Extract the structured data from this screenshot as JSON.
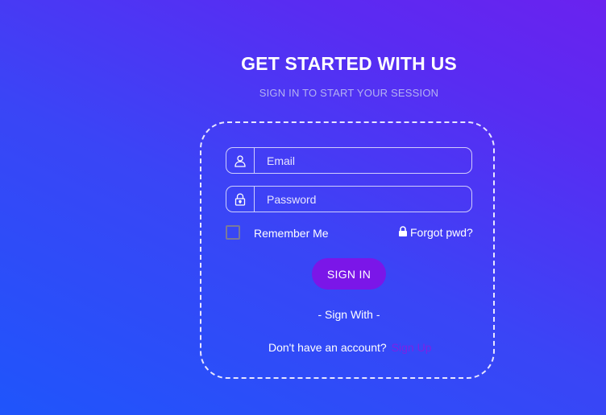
{
  "header": {
    "title": "GET STARTED WITH US",
    "subtitle": "SIGN IN TO START YOUR SESSION"
  },
  "form": {
    "email": {
      "placeholder": "Email",
      "value": "",
      "icon": "user-icon"
    },
    "password": {
      "placeholder": "Password",
      "value": "",
      "icon": "lock-icon"
    },
    "remember_label": "Remember Me",
    "remember_checked": false,
    "forgot_label": "Forgot pwd?",
    "forgot_icon": "lock-icon",
    "signin_label": "SIGN IN",
    "sign_with": "- Sign With -",
    "no_account_text": "Don't have an account?",
    "signup_label": "Sign Up"
  },
  "colors": {
    "background_start": "#1f55fb",
    "background_end": "#6a22ef",
    "button": "#7b16e8",
    "signup_link": "#7b22e6",
    "subtitle": "#b4b2f2"
  }
}
